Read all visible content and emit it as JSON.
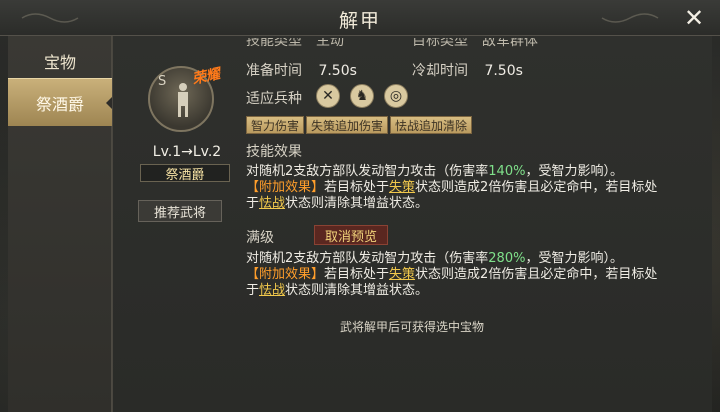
{
  "header": {
    "title": "解甲",
    "close_label": "✕"
  },
  "sidebar": {
    "items": [
      {
        "label": "宝物"
      },
      {
        "label": "祭酒爵"
      }
    ]
  },
  "hero": {
    "portrait_letter": "S",
    "stamp": "荣耀",
    "level": "Lv.1→Lv.2",
    "name": "祭酒爵",
    "recommend_label": "推荐武将"
  },
  "stats": {
    "cut_left": "技能类型　主动",
    "cut_right": "目标类型　敌军群体",
    "prep_label": "准备时间",
    "prep_value": "7.50s",
    "cool_label": "冷却时间",
    "cool_value": "7.50s",
    "troop_label": "适应兵种",
    "troop_icons": [
      "spear-icon",
      "cavalry-icon",
      "bow-icon"
    ]
  },
  "tags": [
    "智力伤害",
    "失策追加伤害",
    "怯战追加清除"
  ],
  "effect": {
    "heading": "技能效果",
    "line1_a": "对随机2支敌方部队发动智力攻击（伤害率",
    "line1_rate": "140%",
    "line1_b": "，受智力影响）。",
    "line2_extra": "【附加效果】",
    "line2_a": "若目标处于",
    "line2_term": "失策",
    "line2_b": "状态则造成2倍伤害且必定命中，若目标处",
    "line3_a": "于",
    "line3_term": "怯战",
    "line3_b": "状态则清除其增益状态。"
  },
  "max": {
    "heading": "满级",
    "preview_button": "取消预览",
    "line1_a": "对随机2支敌方部队发动智力攻击（伤害率",
    "line1_rate": "280%",
    "line1_b": "，受智力影响）。",
    "line2_extra": "【附加效果】",
    "line2_a": "若目标处于",
    "line2_term": "失策",
    "line2_b": "状态则造成2倍伤害且必定命中，若目标处",
    "line3_a": "于",
    "line3_term": "怯战",
    "line3_b": "状态则清除其增益状态。"
  },
  "footer": {
    "note": "武将解甲后可获得选中宝物"
  },
  "colors": {
    "accent_gold": "#c9b07a",
    "rate_green": "#7fe08a",
    "extra_orange": "#ff9e2b",
    "term_yellow": "#f2c94c"
  }
}
